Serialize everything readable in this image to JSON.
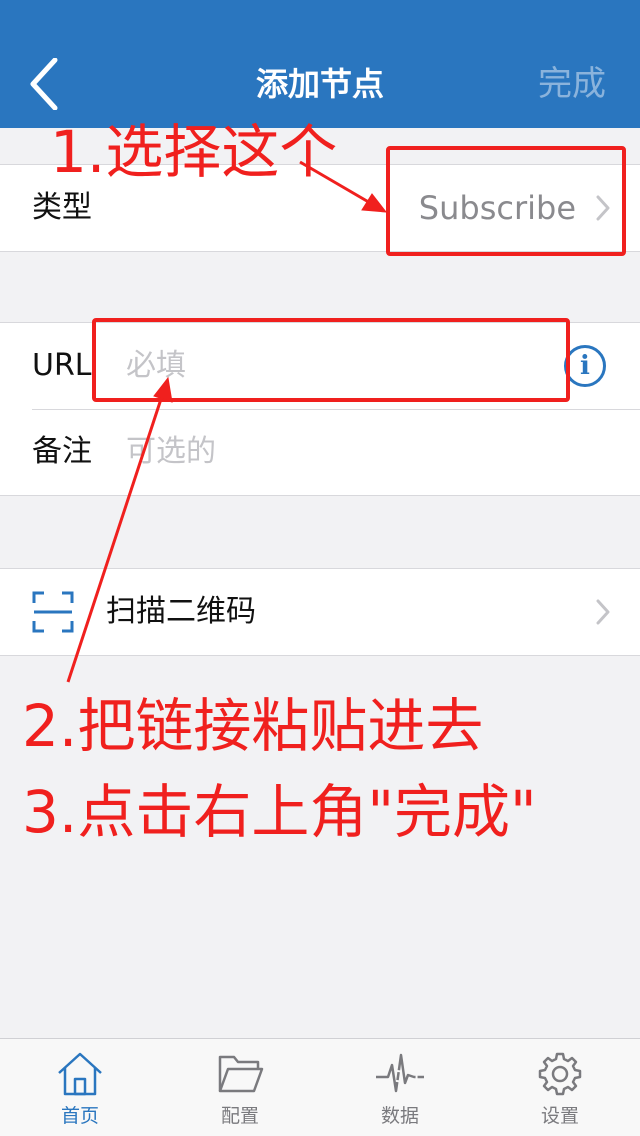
{
  "nav": {
    "title": "添加节点",
    "done": "完成"
  },
  "form": {
    "type": {
      "label": "类型",
      "value": "Subscribe"
    },
    "url": {
      "label": "URL",
      "placeholder": "必填"
    },
    "note": {
      "label": "备注",
      "placeholder": "可选的"
    },
    "scan": {
      "label": "扫描二维码"
    }
  },
  "annotations": {
    "step1": "1.选择这个",
    "step2": "2.把链接粘贴进去",
    "step3": "3.点击右上角\"完成\"",
    "color": "#f0201e"
  },
  "tabs": [
    {
      "label": "首页",
      "icon": "home-icon",
      "active": true
    },
    {
      "label": "配置",
      "icon": "folder-icon"
    },
    {
      "label": "数据",
      "icon": "pulse-icon"
    },
    {
      "label": "设置",
      "icon": "gear-icon"
    }
  ],
  "colors": {
    "accent": "#2a76bf",
    "annotation": "#f0201e"
  }
}
